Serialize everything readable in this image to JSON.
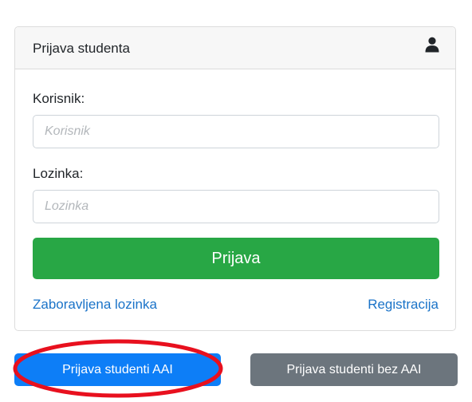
{
  "card": {
    "title": "Prijava studenta",
    "icon": "user-icon"
  },
  "form": {
    "username_label": "Korisnik:",
    "username_placeholder": "Korisnik",
    "username_value": "",
    "password_label": "Lozinka:",
    "password_placeholder": "Lozinka",
    "password_value": "",
    "submit_label": "Prijava"
  },
  "links": {
    "forgot_password": "Zaboravljena lozinka",
    "register": "Registracija"
  },
  "buttons": {
    "aai_label": "Prijava studenti AAI",
    "no_aai_label": "Prijava studenti bez AAI"
  },
  "colors": {
    "success": "#28a745",
    "primary": "#0d7ef7",
    "secondary": "#6c757d",
    "link": "#1a73c8",
    "highlight": "#e8101e"
  }
}
